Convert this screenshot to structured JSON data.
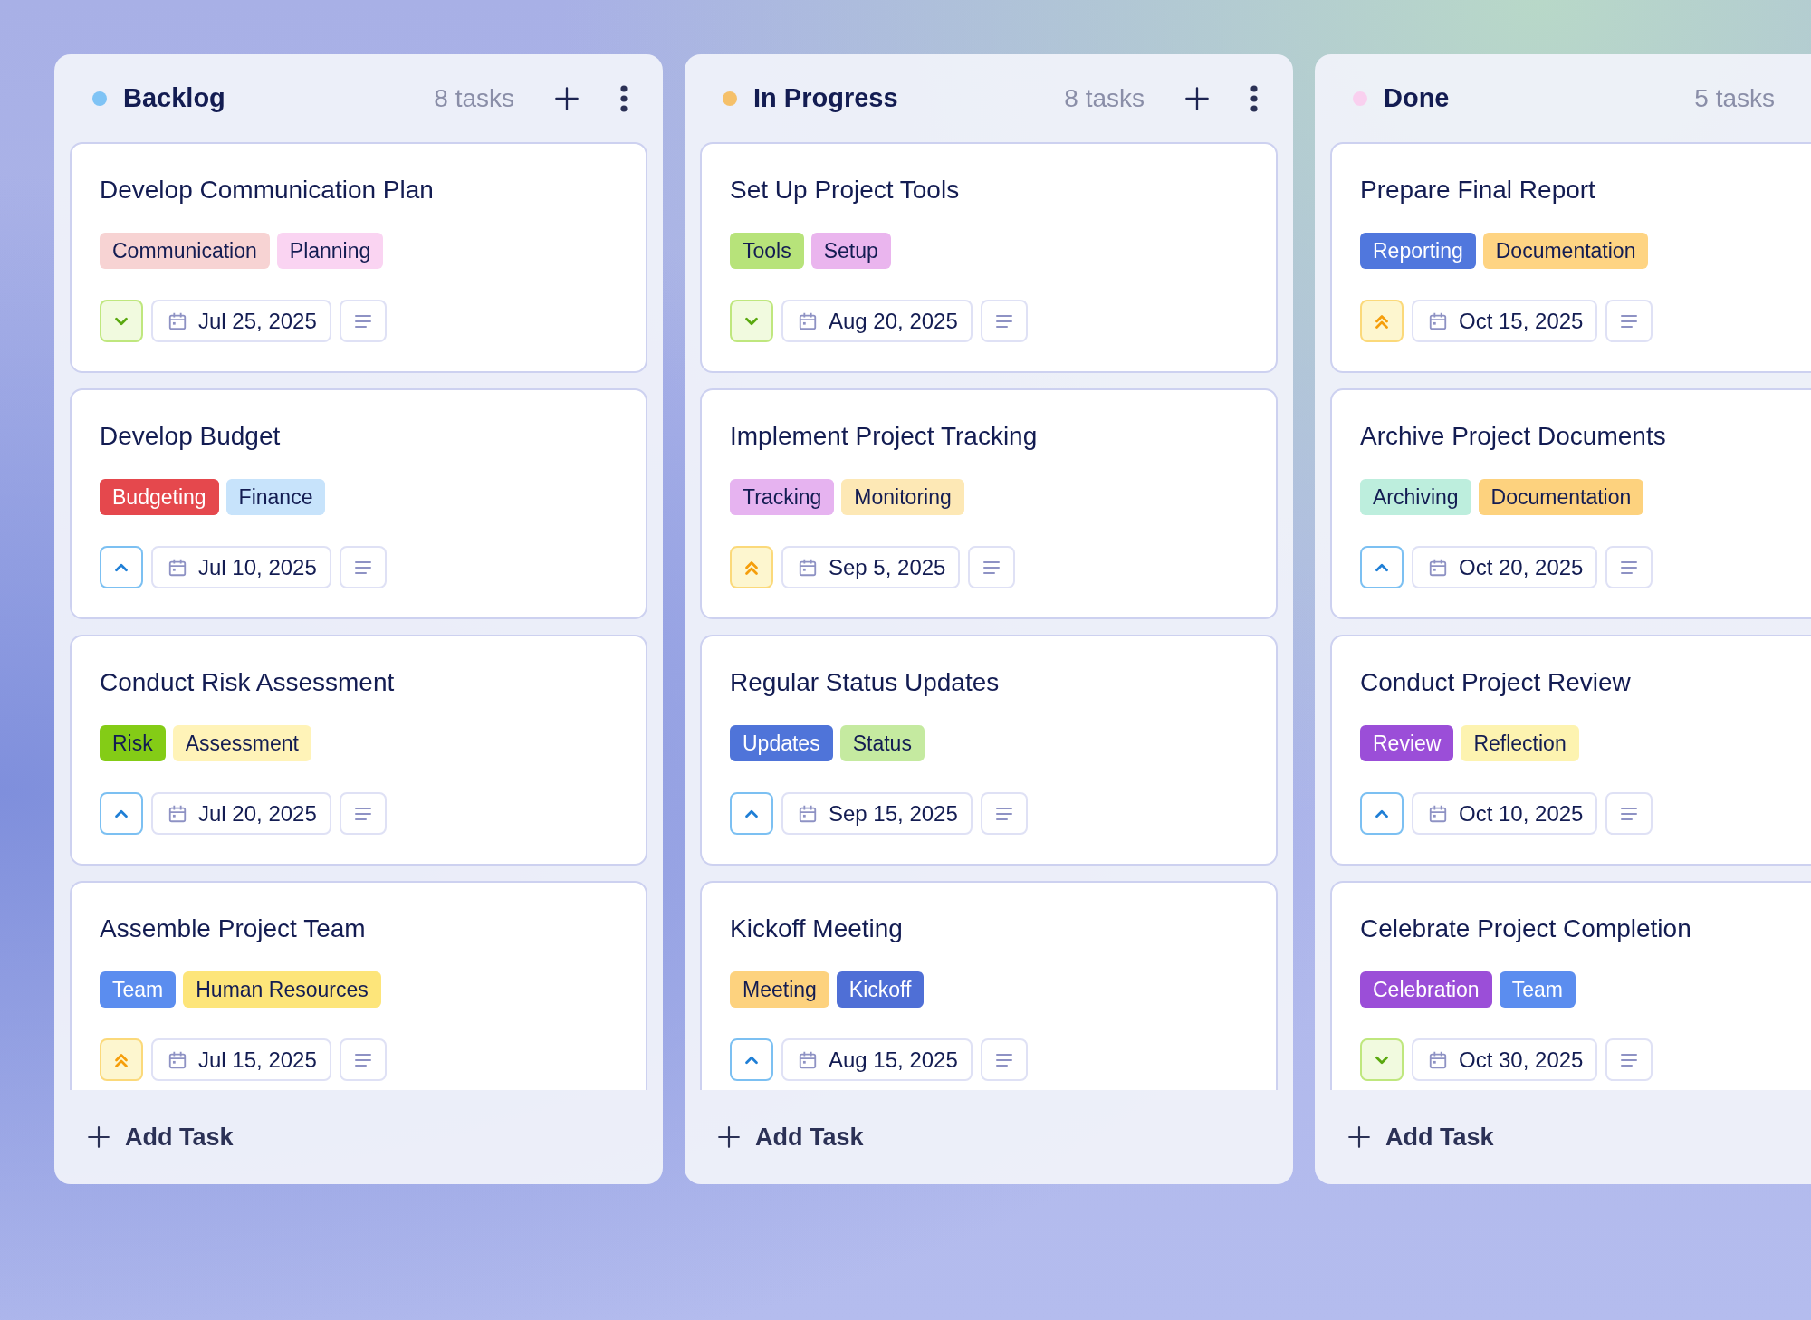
{
  "columns": [
    {
      "title": "Backlog",
      "color": "#7fc3f5",
      "count": "8 tasks",
      "add_label": "Add Task",
      "cards": [
        {
          "title": "Develop Communication Plan",
          "tags": [
            {
              "label": "Communication",
              "color": "#f7d3d3"
            },
            {
              "label": "Planning",
              "color": "#fad4f2"
            }
          ],
          "priority": {
            "kind": "low"
          },
          "date": "Jul 25, 2025"
        },
        {
          "title": "Develop Budget",
          "tags": [
            {
              "label": "Budgeting",
              "color": "#e5484d"
            },
            {
              "label": "Finance",
              "color": "#c7e3fb"
            }
          ],
          "priority": {
            "kind": "medium"
          },
          "date": "Jul 10, 2025"
        },
        {
          "title": "Conduct Risk Assessment",
          "tags": [
            {
              "label": "Risk",
              "color": "#84cc16"
            },
            {
              "label": "Assessment",
              "color": "#fff3b8"
            }
          ],
          "priority": {
            "kind": "medium"
          },
          "date": "Jul 20, 2025"
        },
        {
          "title": "Assemble Project Team",
          "tags": [
            {
              "label": "Team",
              "color": "#5b8def"
            },
            {
              "label": "Human Resources",
              "color": "#fde57a"
            }
          ],
          "priority": {
            "kind": "high"
          },
          "date": "Jul 15, 2025"
        }
      ]
    },
    {
      "title": "In Progress",
      "color": "#f5c06a",
      "count": "8 tasks",
      "add_label": "Add Task",
      "cards": [
        {
          "title": "Set Up Project Tools",
          "tags": [
            {
              "label": "Tools",
              "color": "#b7e37a"
            },
            {
              "label": "Setup",
              "color": "#eab5ee"
            }
          ],
          "priority": {
            "kind": "low"
          },
          "date": "Aug 20, 2025"
        },
        {
          "title": "Implement Project Tracking",
          "tags": [
            {
              "label": "Tracking",
              "color": "#e6b3f0"
            },
            {
              "label": "Monitoring",
              "color": "#fde8b5"
            }
          ],
          "priority": {
            "kind": "high"
          },
          "date": "Sep 5, 2025"
        },
        {
          "title": "Regular Status Updates",
          "tags": [
            {
              "label": "Updates",
              "color": "#4f74d9"
            },
            {
              "label": "Status",
              "color": "#c5eaa0"
            }
          ],
          "priority": {
            "kind": "medium"
          },
          "date": "Sep 15, 2025"
        },
        {
          "title": "Kickoff Meeting",
          "tags": [
            {
              "label": "Meeting",
              "color": "#fdd27e"
            },
            {
              "label": "Kickoff",
              "color": "#4f6fd6"
            }
          ],
          "priority": {
            "kind": "medium"
          },
          "date": "Aug 15, 2025"
        }
      ]
    },
    {
      "title": "Done",
      "color": "#f9d0ef",
      "count": "5 tasks",
      "add_label": "Add Task",
      "cards": [
        {
          "title": "Prepare Final Report",
          "tags": [
            {
              "label": "Reporting",
              "color": "#5077dd"
            },
            {
              "label": "Documentation",
              "color": "#fed483"
            }
          ],
          "priority": {
            "kind": "high"
          },
          "date": "Oct 15, 2025"
        },
        {
          "title": "Archive Project Documents",
          "tags": [
            {
              "label": "Archiving",
              "color": "#bdeedd"
            },
            {
              "label": "Documentation",
              "color": "#fdd27e"
            }
          ],
          "priority": {
            "kind": "medium"
          },
          "date": "Oct 20, 2025"
        },
        {
          "title": "Conduct Project Review",
          "tags": [
            {
              "label": "Review",
              "color": "#9b4ed8"
            },
            {
              "label": "Reflection",
              "color": "#fdf3b0"
            }
          ],
          "priority": {
            "kind": "medium"
          },
          "date": "Oct 10, 2025"
        },
        {
          "title": "Celebrate Project Completion",
          "tags": [
            {
              "label": "Celebration",
              "color": "#9b4ed8"
            },
            {
              "label": "Team",
              "color": "#5b8def"
            }
          ],
          "priority": {
            "kind": "low"
          },
          "date": "Oct 30, 2025"
        }
      ]
    }
  ]
}
